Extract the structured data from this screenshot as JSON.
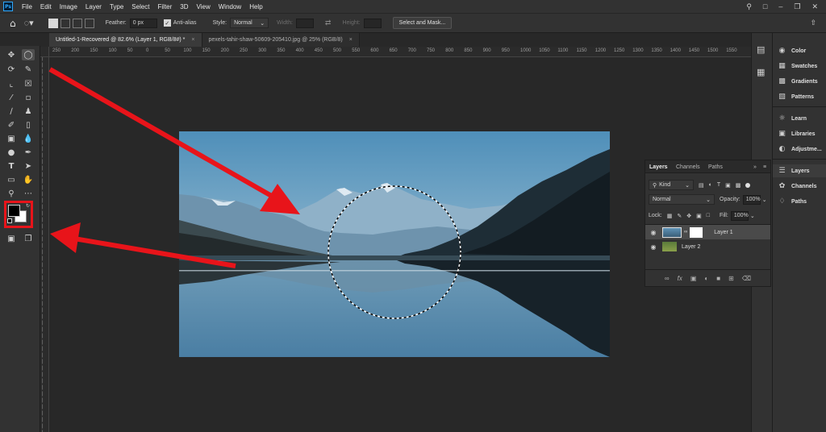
{
  "menubar": {
    "logo": "Ps",
    "items": [
      "File",
      "Edit",
      "Image",
      "Layer",
      "Type",
      "Select",
      "Filter",
      "3D",
      "View",
      "Window",
      "Help"
    ]
  },
  "options": {
    "feather_label": "Feather:",
    "feather_value": "0 px",
    "antialias_label": "Anti-alias",
    "style_label": "Style:",
    "style_value": "Normal",
    "width_label": "Width:",
    "height_label": "Height:",
    "select_mask_label": "Select and Mask..."
  },
  "tabs": [
    {
      "label": "Untitled-1-Recovered @ 82.6% (Layer 1, RGB/8#) *",
      "active": true
    },
    {
      "label": "pexels-tahir-shaw-50609-205410.jpg @ 25% (RGB/8)",
      "active": false
    }
  ],
  "ruler": {
    "h_ticks": [
      "250",
      "200",
      "150",
      "100",
      "50",
      "0",
      "50",
      "100",
      "150",
      "200",
      "250",
      "300",
      "350",
      "400",
      "450",
      "500",
      "550",
      "600",
      "650",
      "700",
      "750",
      "800",
      "850",
      "900",
      "950",
      "1000",
      "1050",
      "1100",
      "1150",
      "1200",
      "1250",
      "1300",
      "1350",
      "1400",
      "1450",
      "1500",
      "1550"
    ]
  },
  "right_panel": {
    "items": [
      "Color",
      "Swatches",
      "Gradients",
      "Patterns",
      "Learn",
      "Libraries",
      "Adjustme...",
      "Layers",
      "Channels",
      "Paths"
    ]
  },
  "layers_panel": {
    "tabs": [
      "Layers",
      "Channels",
      "Paths"
    ],
    "filter_label": "Kind",
    "blend_mode": "Normal",
    "opacity_label": "Opacity:",
    "opacity_value": "100%",
    "lock_label": "Lock:",
    "fill_label": "Fill:",
    "fill_value": "100%",
    "layers": [
      {
        "name": "Layer 1",
        "selected": true
      },
      {
        "name": "Layer 2",
        "selected": false
      }
    ]
  },
  "colors": {
    "annotation": "#e8141a",
    "foreground": "#000000",
    "background": "#ffffff"
  }
}
